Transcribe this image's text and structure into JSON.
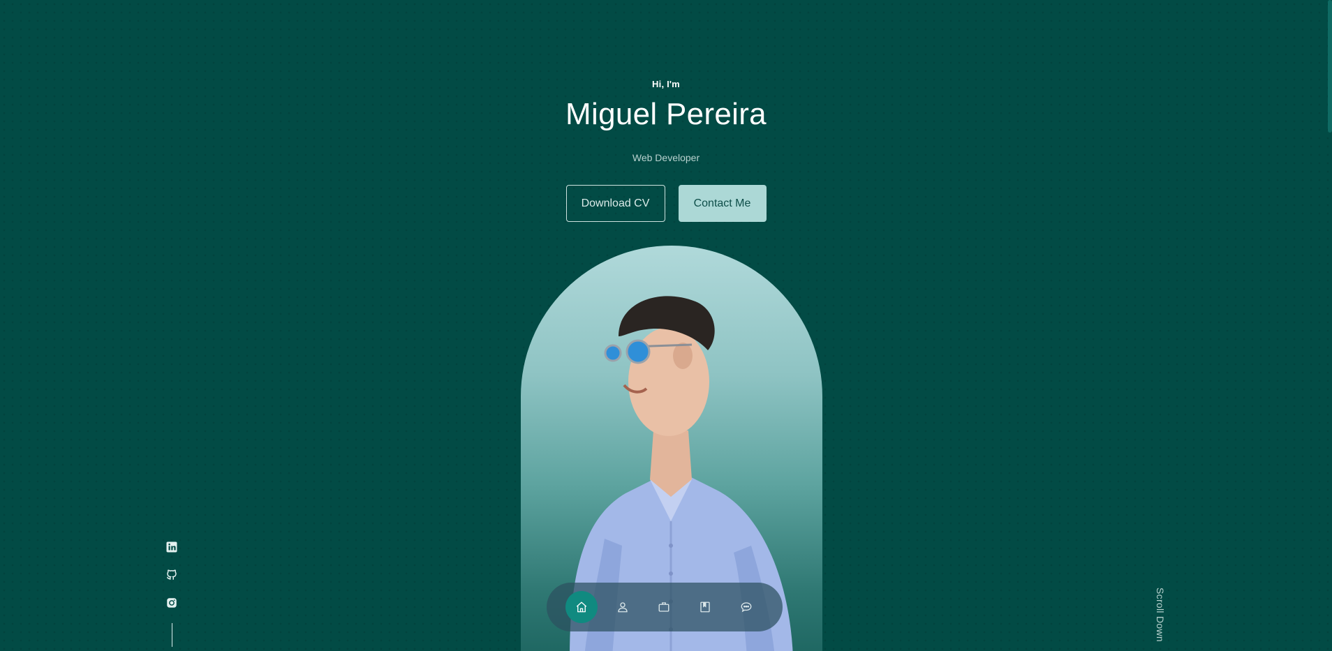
{
  "hero": {
    "greeting": "Hi, I'm",
    "name": "Miguel Pereira",
    "role": "Web Developer",
    "buttons": {
      "download_cv": "Download CV",
      "contact_me": "Contact Me"
    },
    "portrait_alt": "Miguel Pereira"
  },
  "navbar": {
    "items": [
      {
        "icon": "home-icon",
        "active": true
      },
      {
        "icon": "user-icon",
        "active": false
      },
      {
        "icon": "briefcase-icon",
        "active": false
      },
      {
        "icon": "book-icon",
        "active": false
      },
      {
        "icon": "message-icon",
        "active": false
      }
    ]
  },
  "socials": [
    {
      "icon": "linkedin-icon"
    },
    {
      "icon": "github-icon"
    },
    {
      "icon": "instagram-icon"
    }
  ],
  "scroll": {
    "label": "Scroll Down"
  },
  "colors": {
    "background": "#024b45",
    "accent": "#108a80",
    "primary_button": "#acd8d6"
  }
}
